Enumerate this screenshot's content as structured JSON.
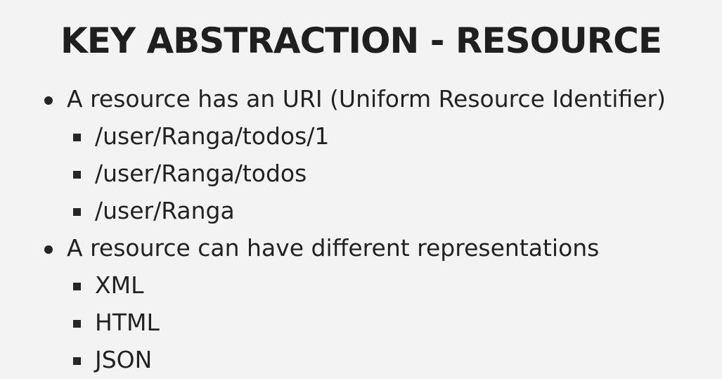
{
  "slide": {
    "title": "KEY ABSTRACTION - RESOURCE",
    "bullets": [
      {
        "text": "A resource has an URI (Uniform Resource Identifier)",
        "subitems": [
          "/user/Ranga/todos/1",
          "/user/Ranga/todos",
          "/user/Ranga"
        ]
      },
      {
        "text": "A resource can have different representations",
        "subitems": [
          "XML",
          "HTML",
          "JSON"
        ]
      }
    ]
  }
}
